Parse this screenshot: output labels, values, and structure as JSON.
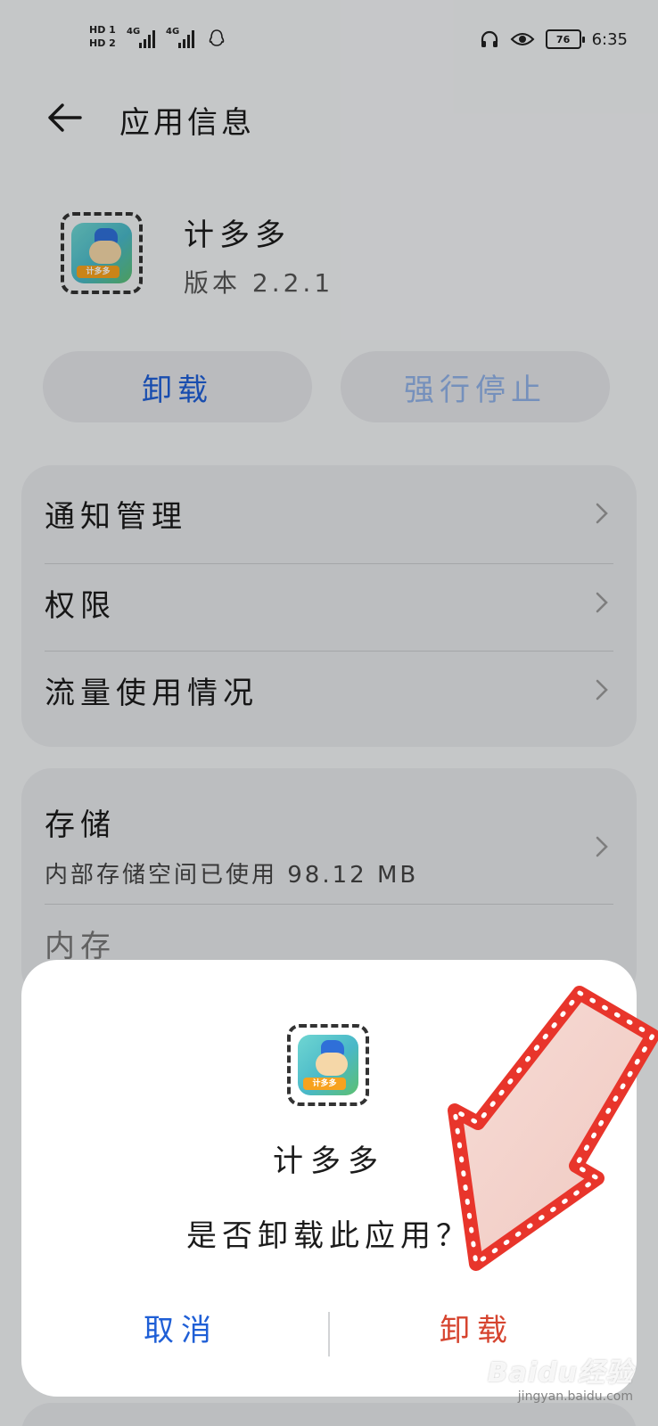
{
  "status_bar": {
    "sim1": "HD 1",
    "sim2": "HD 2",
    "net1": "4G",
    "net2": "4G",
    "battery": "76",
    "time": "6:35"
  },
  "header": {
    "title": "应用信息"
  },
  "app": {
    "name": "计多多",
    "version": "版本 2.2.1",
    "icon_tag": "计多多"
  },
  "actions": {
    "uninstall": "卸载",
    "force_stop": "强行停止"
  },
  "settings_card": {
    "items": [
      {
        "label": "通知管理"
      },
      {
        "label": "权限"
      },
      {
        "label": "流量使用情况"
      }
    ]
  },
  "storage_card": {
    "storage_label": "存储",
    "storage_detail": "内部存储空间已使用 98.12 MB",
    "memory_label": "内存"
  },
  "dialog": {
    "app_name": "计多多",
    "message": "是否卸载此应用？",
    "cancel": "取消",
    "confirm": "卸载"
  },
  "watermark": {
    "main": "Baidu经验",
    "sub": "jingyan.baidu.com"
  },
  "colors": {
    "accent_blue": "#1f5fd6",
    "danger_red": "#d6442f",
    "arrow_red": "#e8352b"
  }
}
